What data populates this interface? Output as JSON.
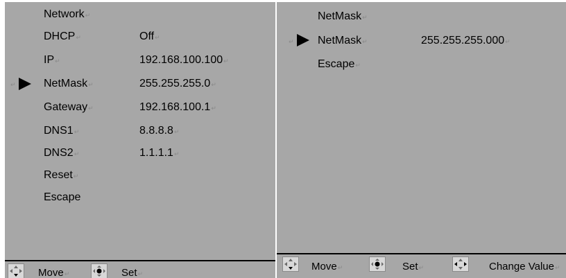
{
  "left_panel": {
    "items": [
      {
        "label": "Network",
        "value": "",
        "label_mark": "↵",
        "value_mark": ""
      },
      {
        "label": "DHCP",
        "value": "Off",
        "label_mark": "↵",
        "value_mark": "↵"
      },
      {
        "label": "IP",
        "value": "192.168.100.100",
        "label_mark": "↵",
        "value_mark": "↵"
      },
      {
        "label": "NetMask",
        "value": "255.255.255.0",
        "label_mark": "↵",
        "value_mark": "↵"
      },
      {
        "label": "Gateway",
        "value": "192.168.100.1",
        "label_mark": "↵",
        "value_mark": "↵"
      },
      {
        "label": "DNS1",
        "value": "8.8.8.8",
        "label_mark": "↵",
        "value_mark": "↵"
      },
      {
        "label": "DNS2",
        "value": "1.1.1.1",
        "label_mark": "↵",
        "value_mark": "↵"
      },
      {
        "label": "Reset",
        "value": "",
        "label_mark": "↵",
        "value_mark": ""
      },
      {
        "label": "Escape",
        "value": "",
        "label_mark": "",
        "value_mark": ""
      }
    ],
    "selected_label": "NetMask",
    "footer": {
      "move_label": "Move",
      "set_label": "Set",
      "mark": "↵"
    }
  },
  "right_panel": {
    "title": "NetMask",
    "title_mark": "↵",
    "selected": {
      "label": "NetMask",
      "value": "255.255.255.000",
      "label_mark": "↵",
      "value_mark": "↵"
    },
    "escape": {
      "label": "Escape",
      "mark": "↵"
    },
    "footer": {
      "move_label": "Move",
      "set_label": "Set",
      "change_label": "Change Value",
      "mark": "↵"
    }
  },
  "cursor_mark": "↵",
  "icons": [
    "move-arrows-icon",
    "set-center-icon",
    "change-value-icon"
  ],
  "colors": {
    "panel_bg": "#a7a7a7",
    "text": "#000000",
    "cursor": "#000000",
    "divider": "#000000"
  }
}
